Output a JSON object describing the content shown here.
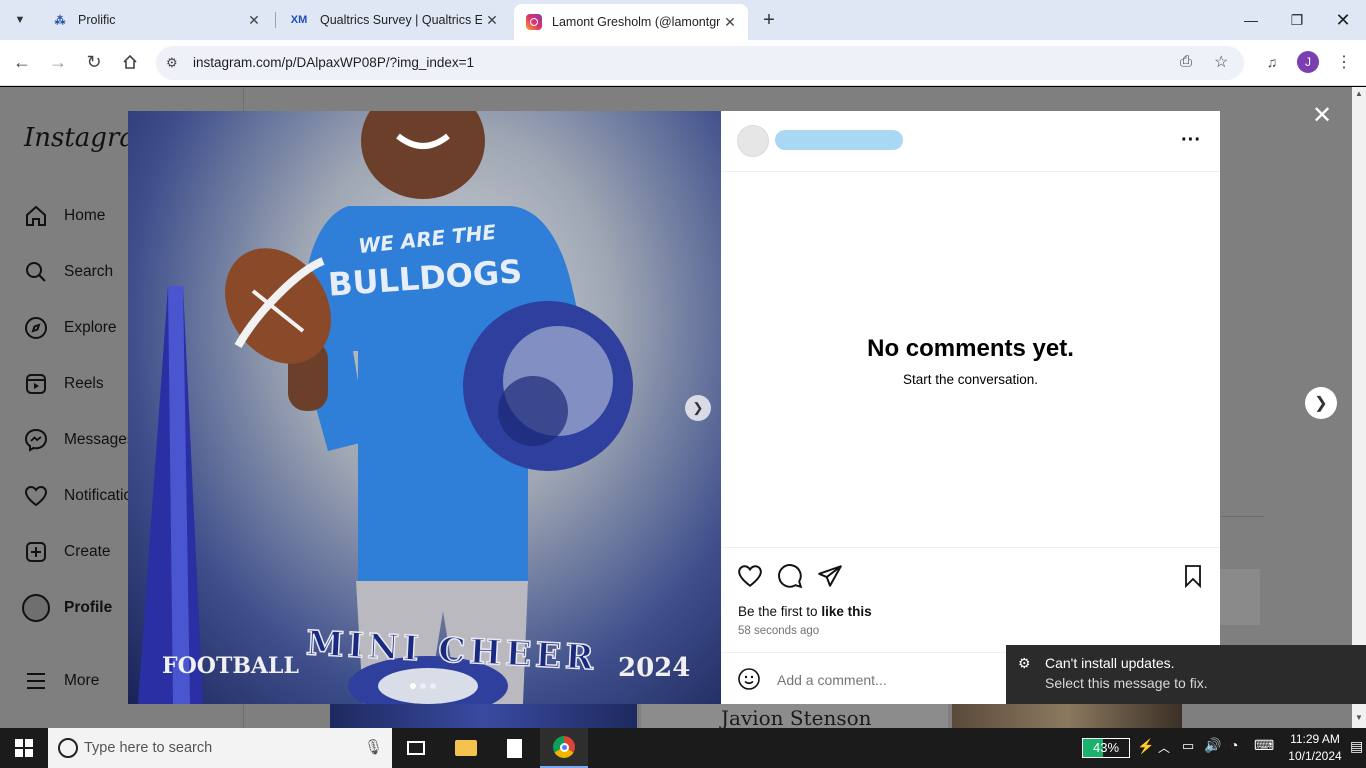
{
  "browser": {
    "tabs": [
      {
        "title": "Prolific",
        "favicon": "P"
      },
      {
        "title": "Qualtrics Survey | Qualtrics Exp",
        "favicon": "XM"
      },
      {
        "title": "Lamont Gresholm (@lamontgre",
        "favicon": "IG"
      }
    ],
    "new_tab": "+",
    "url": "instagram.com/p/DAlpaxWP08P/?img_index=1"
  },
  "sidebar": {
    "logo": "Instagram",
    "items": [
      {
        "label": "Home"
      },
      {
        "label": "Search"
      },
      {
        "label": "Explore"
      },
      {
        "label": "Reels"
      },
      {
        "label": "Messages"
      },
      {
        "label": "Notifications"
      },
      {
        "label": "Create"
      },
      {
        "label": "Profile"
      },
      {
        "label": "More"
      }
    ]
  },
  "post": {
    "image_text": {
      "shirt_line1": "WE ARE THE",
      "shirt_line2": "BULLDOGS",
      "left_banner": "FOOTBALL",
      "arc_text": "MINI CHEER",
      "year": "2024"
    },
    "more_label": "···",
    "no_comments_title": "No comments yet.",
    "no_comments_sub": "Start the conversation.",
    "likes_prefix": "Be the first to",
    "likes_link": "like this",
    "timestamp": "58 seconds ago",
    "comment_placeholder": "Add a comment..."
  },
  "background_post": {
    "name_text": "Javion Stenson"
  },
  "toast": {
    "title": "Can't install updates.",
    "message": "Select this message to fix."
  },
  "taskbar": {
    "search_placeholder": "Type here to search",
    "battery": "43%",
    "time": "11:29 AM",
    "date": "10/1/2024"
  },
  "colors": {
    "overlay": "#7f7f7f",
    "tabbar": "#dfe7f5",
    "blur_username": "#a9d8f5",
    "toast_bg": "#2b2b2b"
  }
}
